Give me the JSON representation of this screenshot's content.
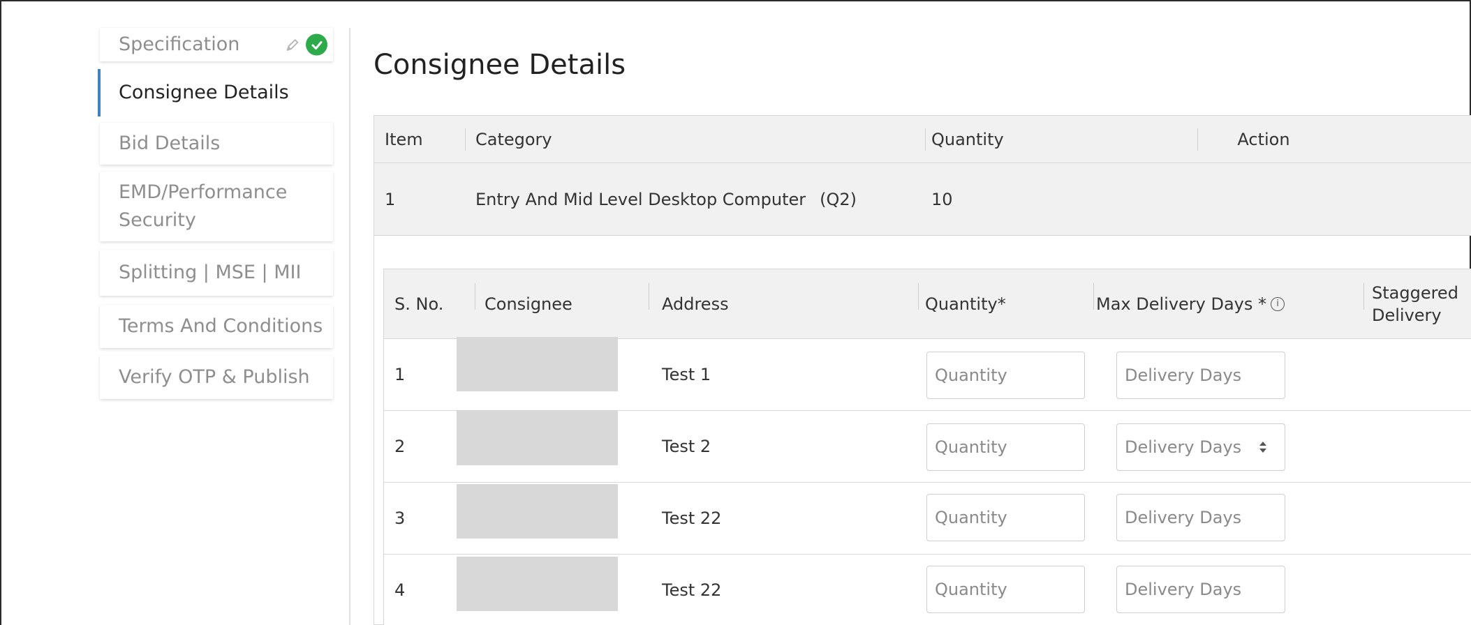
{
  "sidebar": {
    "items": [
      {
        "label": "Specification"
      },
      {
        "label": "Consignee Details"
      },
      {
        "label": "Bid Details"
      },
      {
        "label": "EMD/Performance Security"
      },
      {
        "label": "Splitting | MSE | MII"
      },
      {
        "label": "Terms And Conditions"
      },
      {
        "label": "Verify OTP & Publish"
      }
    ]
  },
  "main": {
    "title": "Consignee Details",
    "item_table": {
      "headers": {
        "item": "Item",
        "category": "Category",
        "quantity": "Quantity",
        "action": "Action"
      },
      "row": {
        "item": "1",
        "category": "Entry And Mid Level Desktop Computer",
        "code": "(Q2)",
        "quantity": "10"
      }
    },
    "consignee_table": {
      "headers": {
        "sno": "S. No.",
        "consignee": "Consignee",
        "address": "Address",
        "quantity": "Quantity*",
        "max_delivery": "Max Delivery Days *",
        "staggered_line1": "Staggered",
        "staggered_line2": "Delivery"
      },
      "quantity_placeholder": "Quantity",
      "delivery_placeholder": "Delivery Days",
      "rows": [
        {
          "sno": "1",
          "address": "Test 1"
        },
        {
          "sno": "2",
          "address": "Test 2"
        },
        {
          "sno": "3",
          "address": "Test 22"
        },
        {
          "sno": "4",
          "address": "Test 22"
        }
      ]
    }
  },
  "colors": {
    "accent": "#3b82c8",
    "success": "#2daa4a",
    "header_bg": "#f1f1f1",
    "redacted": "#d8d8d8"
  },
  "icons": {
    "edit": "pencil-icon",
    "done": "check-circle-icon",
    "info": "info-icon",
    "spinner": "spinner-icon"
  }
}
